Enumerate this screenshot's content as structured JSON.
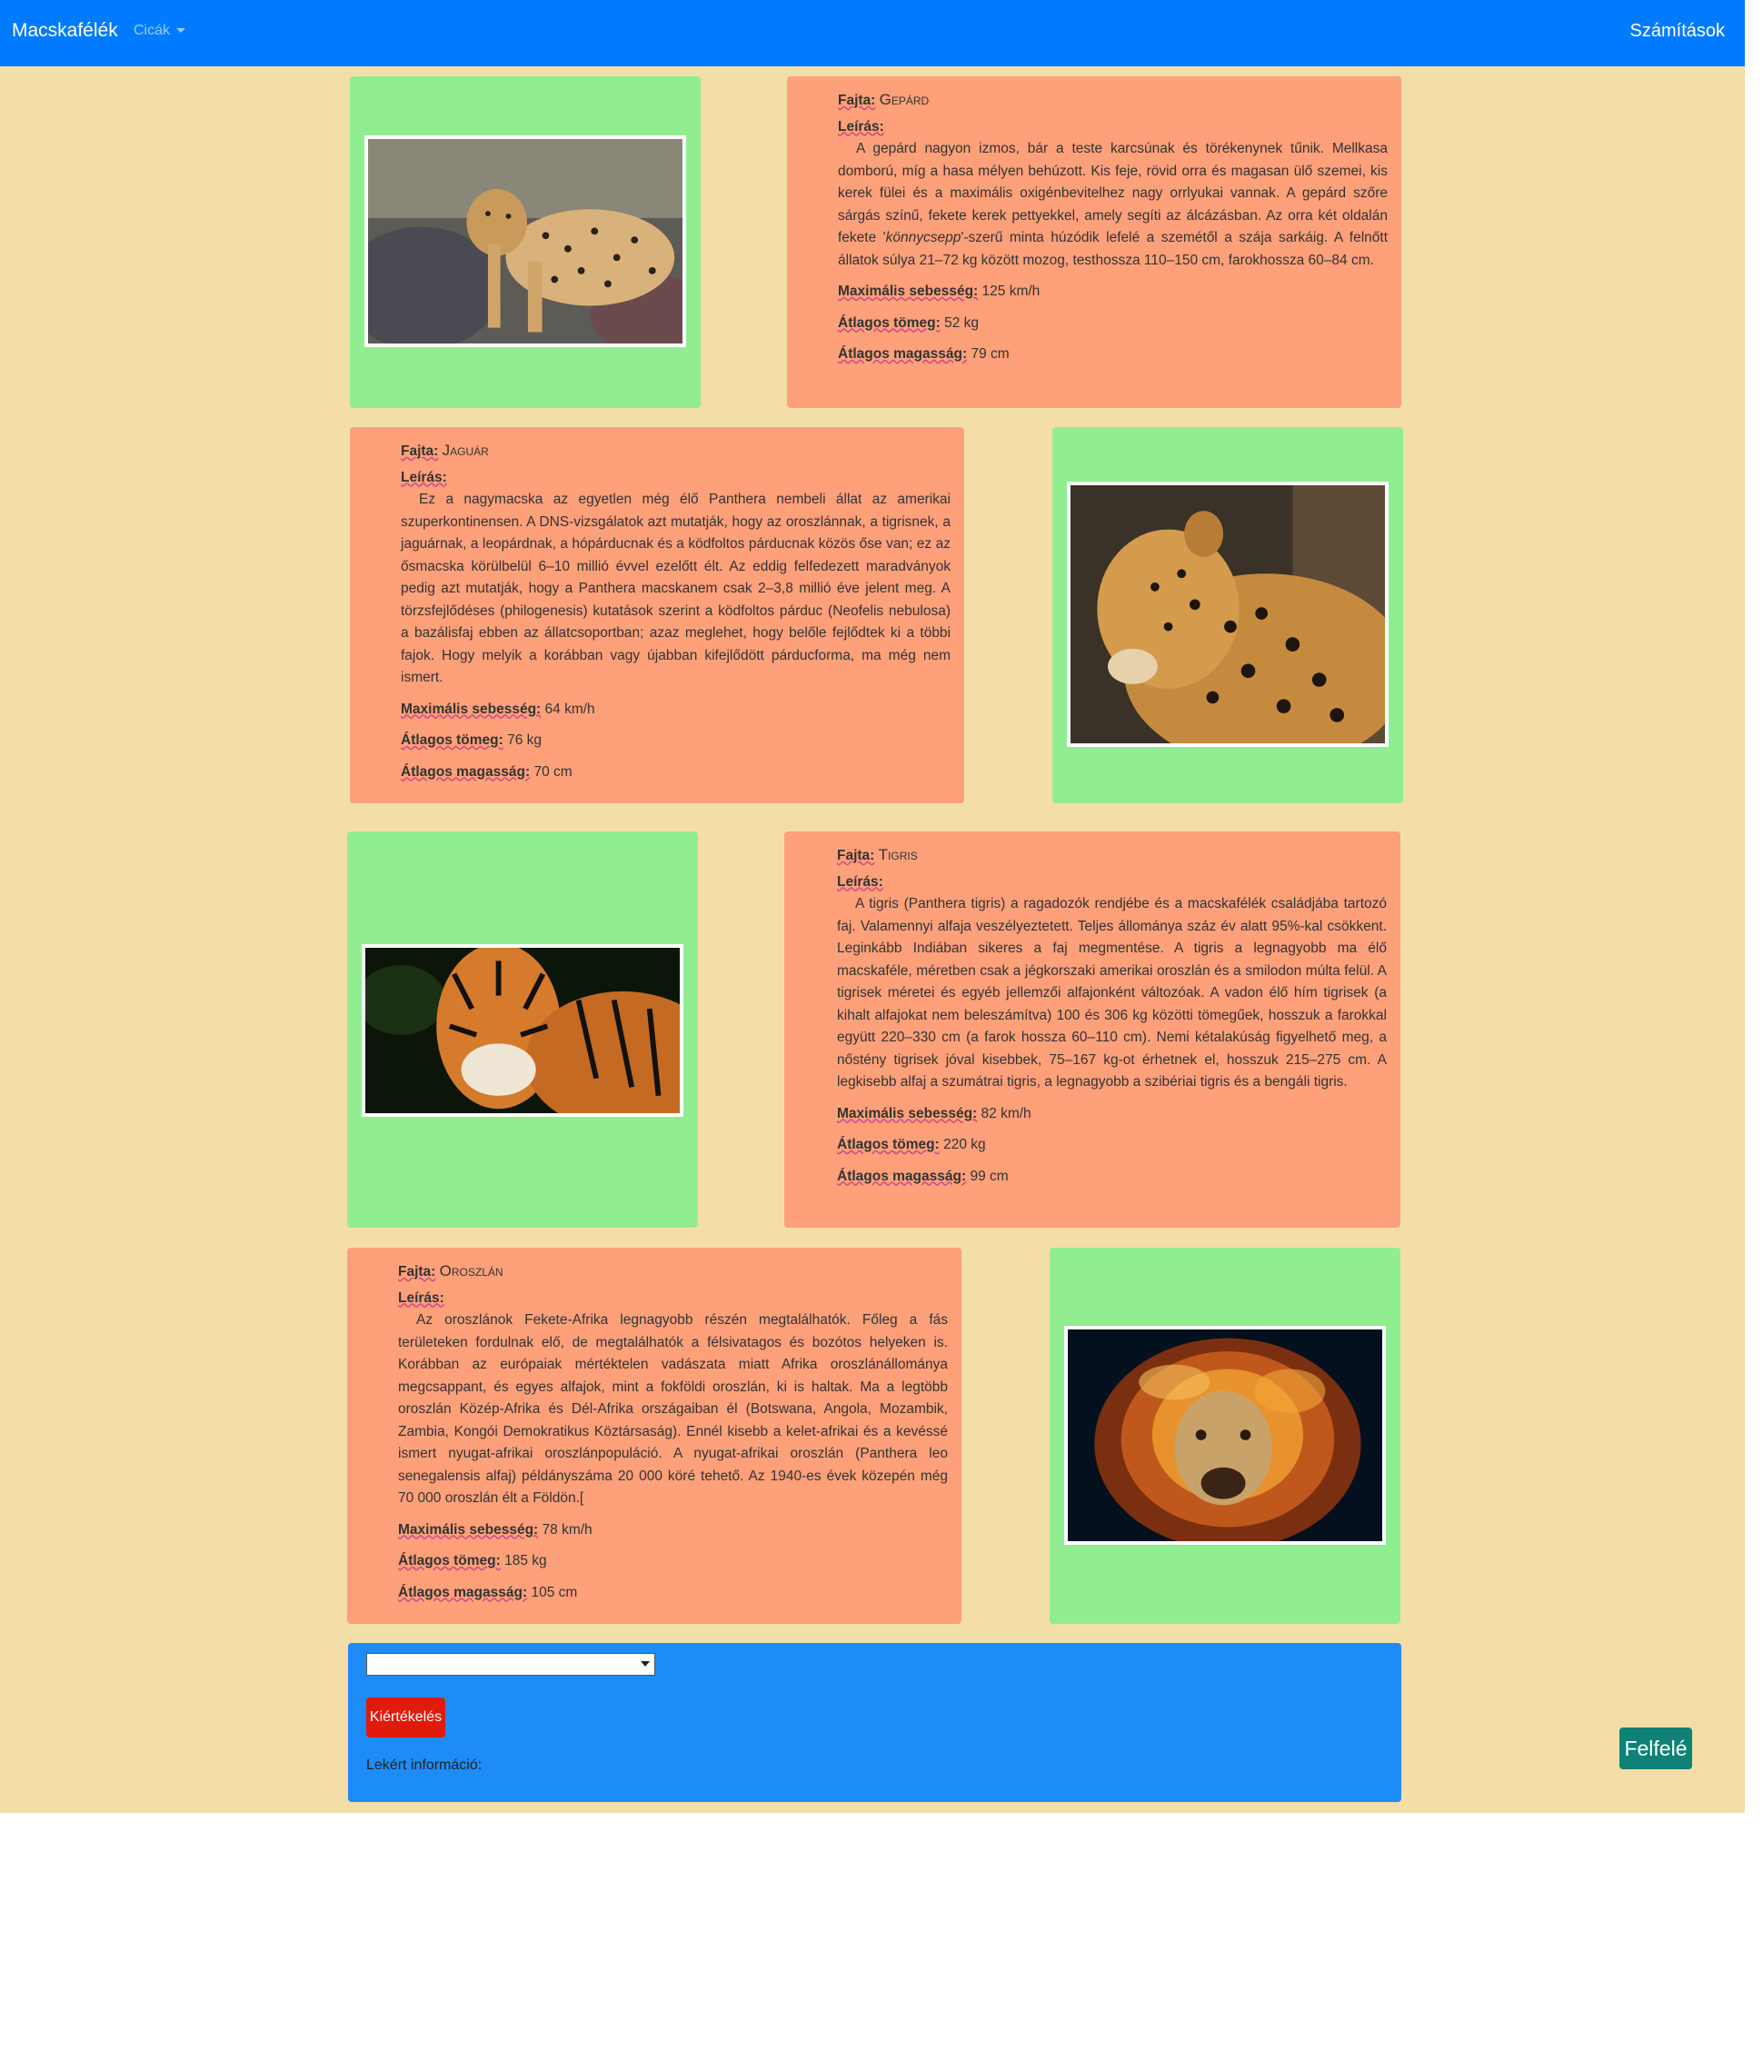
{
  "navbar": {
    "brand": "Macskafélék",
    "dropdown": "Cicák",
    "right_link": "Számítások"
  },
  "labels": {
    "breed": "Fajta:",
    "description": "Leírás:",
    "speed": "Maximális sebesség:",
    "weight": "Átlagos tömeg:",
    "height": "Átlagos magasság:"
  },
  "cats": [
    {
      "name": "Gepárd",
      "desc": "A gepárd nagyon izmos, bár a teste karcsúnak és törékenynek tűnik. Mellkasa domború, míg a hasa mélyen behúzott. Kis feje, rövid orra és magasan ülő szemei, kis kerek fülei és a maximális oxigénbevitelhez nagy orrlyukai vannak. A gepárd szőre sárgás színű, fekete kerek pettyekkel, amely segíti az álcázásban. Az orra két oldalán fekete '",
      "desc_em": "könnycsepp",
      "desc_end": "'-szerű minta húzódik lefelé a szemétől a szája sarkáig. A felnőtt állatok súlya 21–72 kg között mozog, testhossza 110–150 cm, farokhossza 60–84 cm.",
      "speed": "125 km/h",
      "weight": "52 kg",
      "height": "79 cm"
    },
    {
      "name": "Jaguár",
      "desc": "Ez a nagymacska az egyetlen még élő Panthera nembeli állat az amerikai szuperkontinensen. A DNS-vizsgálatok azt mutatják, hogy az oroszlánnak, a tigrisnek, a jaguárnak, a leopárdnak, a hópárducnak és a ködfoltos párducnak közös őse van; ez az ősmacska körülbelül 6–10 millió évvel ezelőtt élt. Az eddig felfedezett maradványok pedig azt mutatják, hogy a Panthera macskanem csak 2–3,8 millió éve jelent meg. A törzsfejlődéses (philogenesis) kutatások szerint a ködfoltos párduc (Neofelis nebulosa) a bazálisfaj ebben az állatcsoportban; azaz meglehet, hogy belőle fejlődtek ki a többi fajok. Hogy melyik a korábban vagy újabban kifejlődött párducforma, ma még nem ismert.",
      "speed": "64 km/h",
      "weight": "76 kg",
      "height": "70 cm"
    },
    {
      "name": "Tigris",
      "desc": "A tigris (Panthera tigris) a ragadozók rendjébe és a macskafélék családjába tartozó faj. Valamennyi alfaja veszélyeztetett. Teljes állománya száz év alatt 95%-kal csökkent. Leginkább Indiában sikeres a faj megmentése. A tigris a legnagyobb ma élő macskaféle, méretben csak a jégkorszaki amerikai oroszlán és a smilodon múlta felül. A tigrisek méretei és egyéb jellemzői alfajonként változóak. A vadon élő hím tigrisek (a kihalt alfajokat nem beleszámítva) 100 és 306 kg közötti tömegűek, hosszuk a farokkal együtt 220–330 cm (a farok hossza 60–110 cm). Nemi kétalakúság figyelhető meg, a nőstény tigrisek jóval kisebbek, 75–167 kg-ot érhetnek el, hosszuk 215–275 cm. A legkisebb alfaj a szumátrai tigris, a legnagyobb a szibériai tigris és a bengáli tigris.",
      "speed": "82 km/h",
      "weight": "220 kg",
      "height": "99 cm"
    },
    {
      "name": "Oroszlán",
      "desc": "Az oroszlánok Fekete-Afrika legnagyobb részén megtalálhatók. Főleg a fás területeken fordulnak elő, de megtalálhatók a félsivatagos és bozótos helyeken is. Korábban az európaiak mértéktelen vadászata miatt Afrika oroszlánállománya megcsappant, és egyes alfajok, mint a fokföldi oroszlán, ki is haltak. Ma a legtöbb oroszlán Közép-Afrika és Dél-Afrika országaiban él (Botswana, Angola, Mozambik, Zambia, Kongói Demokratikus Köztársaság). Ennél kisebb a kelet-afrikai és a kevéssé ismert nyugat-afrikai oroszlánpopuláció. A nyugat-afrikai oroszlán (Panthera leo senegalensis alfaj) példányszáma 20 000 köré tehető. Az 1940-es évek közepén még 70 000 oroszlán élt a Földön.[",
      "speed": "78 km/h",
      "weight": "185 kg",
      "height": "105 cm"
    }
  ],
  "panel": {
    "select_value": "",
    "button": "Kiértékelés",
    "result_label": "Lekért információ:"
  },
  "up_button": "Felfelé",
  "colors": {
    "navbar": "#007bff",
    "page_bg": "#f3dea8",
    "image_box": "#90ee90",
    "text_box": "#fea07a",
    "panel": "#1e8cf7",
    "eval_button": "#e01b0b",
    "up_button": "#0f8176"
  }
}
